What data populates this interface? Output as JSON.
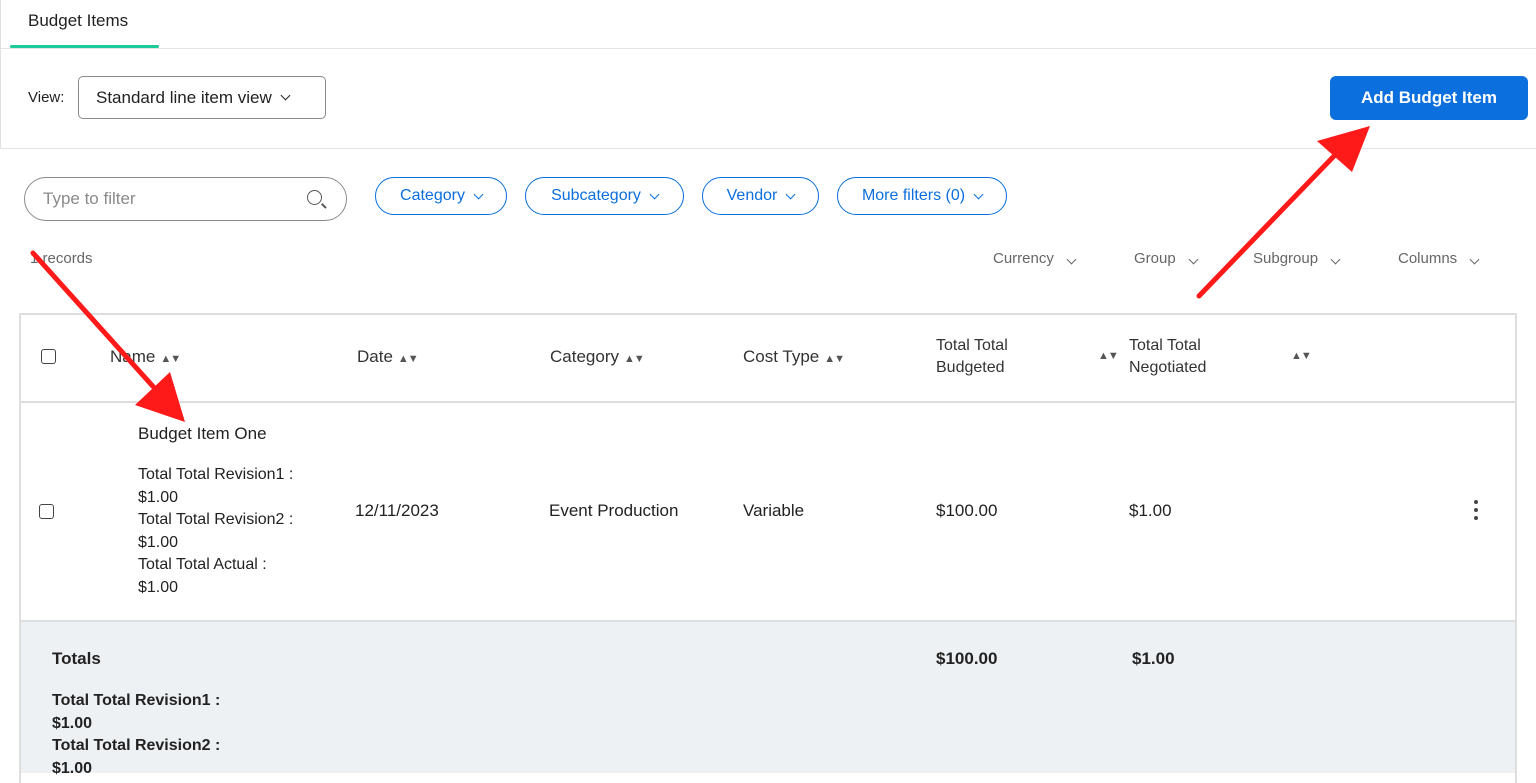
{
  "tabs": {
    "active": "Budget Items"
  },
  "toolbar": {
    "view_label": "View:",
    "view_value": "Standard line item view",
    "add_button": "Add Budget Item"
  },
  "filters": {
    "search_placeholder": "Type to filter",
    "category": "Category",
    "subcategory": "Subcategory",
    "vendor": "Vendor",
    "more": "More filters (0)"
  },
  "records_text": "1 records",
  "options": {
    "currency": "Currency",
    "group": "Group",
    "subgroup": "Subgroup",
    "columns": "Columns"
  },
  "table": {
    "headers": {
      "name": "Name",
      "date": "Date",
      "category": "Category",
      "cost_type": "Cost Type",
      "budgeted_1": "Total Total",
      "budgeted_2": "Budgeted",
      "negotiated_1": "Total Total",
      "negotiated_2": "Negotiated"
    },
    "rows": [
      {
        "name": "Budget Item One",
        "details": [
          "Total Total Revision1 :",
          "$1.00",
          "Total Total Revision2 :",
          "$1.00",
          "Total Total Actual :",
          "$1.00"
        ],
        "date": "12/11/2023",
        "category": "Event Production",
        "cost_type": "Variable",
        "budgeted": "$100.00",
        "negotiated": "$1.00"
      }
    ],
    "totals": {
      "label": "Totals",
      "budgeted": "$100.00",
      "negotiated": "$1.00",
      "details": [
        "Total Total Revision1 :",
        "$1.00",
        "Total Total Revision2 :",
        "$1.00"
      ]
    }
  },
  "colors": {
    "accent": "#0b6fdd",
    "tab_underline": "#1ec99a",
    "arrow": "#ff1a1a"
  }
}
